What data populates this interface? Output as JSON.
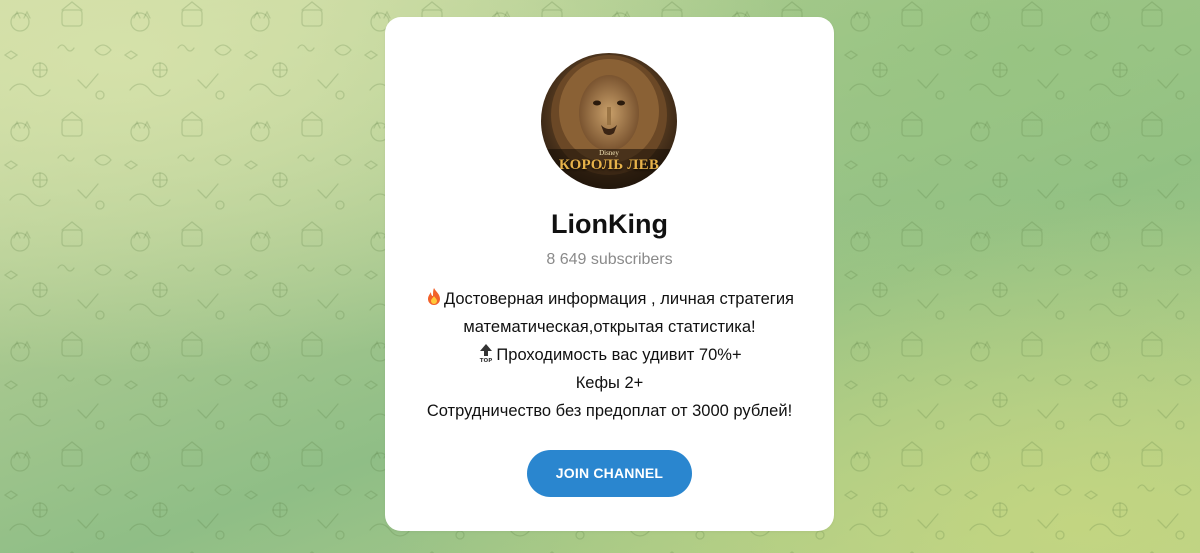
{
  "channel": {
    "avatar": {
      "title_text": "КОРОЛЬ ЛЕВ",
      "brand_text": "Disney"
    },
    "name": "LionKing",
    "subscribers": "8 649 subscribers",
    "description": [
      {
        "icon": "fire-icon",
        "text": "Достоверная информация , личная стратегия"
      },
      {
        "icon": "",
        "text": "математическая,открытая статистика!"
      },
      {
        "icon": "top-arrow-icon",
        "text": "Проходимость вас удивит 70%+"
      },
      {
        "icon": "",
        "text": "Кефы 2+"
      },
      {
        "icon": "",
        "text": "Сотрудничество без предоплат от 3000 рублей!"
      }
    ],
    "join_label": "JOIN CHANNEL"
  },
  "colors": {
    "button": "#2a86cf",
    "background_green": "#a8c88f",
    "card": "#ffffff"
  }
}
